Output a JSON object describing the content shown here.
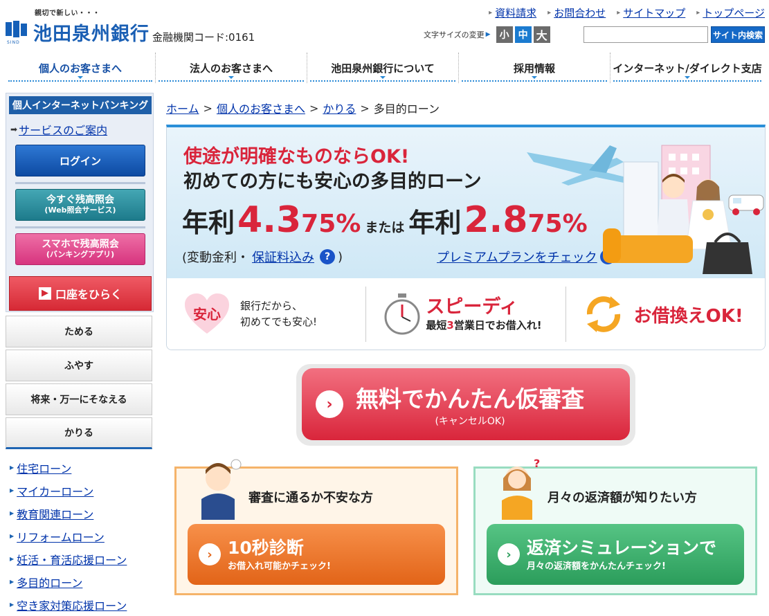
{
  "header": {
    "tagline": "親切で新しい・・・",
    "bank_name": "池田泉州銀行",
    "bank_code": "金融機関コード:0161",
    "logo_sub": "SIND",
    "top_links": [
      "資料請求",
      "お問合わせ",
      "サイトマップ",
      "トップページ"
    ],
    "font_size_label": "文字サイズの変更",
    "font_sizes": [
      "小",
      "中",
      "大"
    ],
    "search_placeholder": "",
    "search_button": "サイト内検索"
  },
  "nav": {
    "items": [
      "個人のお客さまへ",
      "法人のお客さまへ",
      "池田泉州銀行について",
      "採用情報",
      "インターネット/ダイレクト支店"
    ],
    "active_index": 0
  },
  "sidebar": {
    "ib_title": "個人インターネットバンキング",
    "service_link": "サービスのご案内",
    "login": "ログイン",
    "web_line1": "今すぐ残高照会",
    "web_line2": "(Web照会サービス)",
    "app_line1": "スマホで残高照会",
    "app_line2": "(バンキングアプリ)",
    "open_account": "口座をひらく",
    "menu": [
      "ためる",
      "ふやす",
      "将来・万一にそなえる",
      "かりる"
    ],
    "sub_links": [
      "住宅ローン",
      "マイカーローン",
      "教育関連ローン",
      "リフォームローン",
      "妊活・育活応援ローン",
      "多目的ローン",
      "空き家対策応援ローン"
    ]
  },
  "breadcrumb": {
    "items": [
      "ホーム",
      "個人のお客さまへ",
      "かりる"
    ],
    "current": "多目的ローン"
  },
  "hero": {
    "headline1": "使途が明確なものならOK!",
    "headline2": "初めての方にも安心の多目的ローン",
    "rate_label": "年利",
    "rate1_big": "4.3",
    "rate1_small": "75",
    "pct": "%",
    "or": "または",
    "rate2_big": "2.8",
    "rate2_small": "75",
    "note_prefix": "(変動金利・",
    "note_link": "保証料込み",
    "note_suffix": ")",
    "premium_link": "プレミアムプランをチェック",
    "qmark": "?"
  },
  "features": {
    "anshin_badge": "安心",
    "anshin_line1": "銀行だから、",
    "anshin_line2": "初めてでも安心!",
    "speedy_title": "スピーディ",
    "speedy_pre": "最短",
    "speedy_num": "3",
    "speedy_post": "営業日でお借入れ!",
    "refi_title": "お借換えOK!"
  },
  "cta": {
    "main": "無料でかんたん仮審査",
    "sub": "(キャンセルOK)"
  },
  "cards": [
    {
      "question": "審査に通るか不安な方",
      "btn1": "10秒診断",
      "btn2": "お借入れ可能かチェック!"
    },
    {
      "question": "月々の返済額が知りたい方",
      "btn1": "返済シミュレーションで",
      "btn2": "月々の返済額をかんたんチェック!"
    }
  ],
  "colors": {
    "brand_blue": "#1a5fb4",
    "accent_red": "#d9253b",
    "orange": "#e26418",
    "green": "#2b9d5b"
  }
}
